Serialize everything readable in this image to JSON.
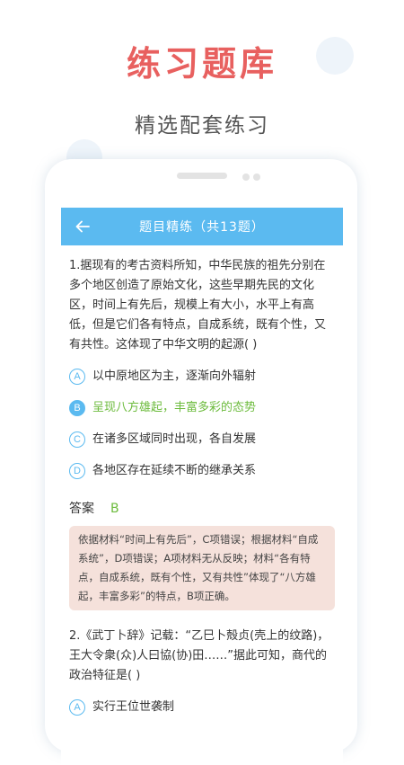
{
  "promo": {
    "title": "练习题库",
    "subtitle": "精选配套练习"
  },
  "app": {
    "header_title": "题目精练（共13题）",
    "back_icon": "arrow-left-icon",
    "accent": "#5bbaf0",
    "correct_color": "#6cbb3c"
  },
  "questions": [
    {
      "stem": "1.据现有的考古资料所知，中华民族的祖先分别在多个地区创造了原始文化，这些早期先民的文化区，时间上有先后，规模上有大小，水平上有高低，但是它们各有特点，自成系统，既有个性，又有共性。这体现了中华文明的起源(  )",
      "options": [
        {
          "letter": "A",
          "text": "以中原地区为主，逐渐向外辐射"
        },
        {
          "letter": "B",
          "text": "呈现八方雄起，丰富多彩的态势"
        },
        {
          "letter": "C",
          "text": "在诸多区域同时出现，各自发展"
        },
        {
          "letter": "D",
          "text": "各地区存在延续不断的继承关系"
        }
      ],
      "selected": "B",
      "answer_label": "答案",
      "answer": "B",
      "explanation": "依据材料“时间上有先后”，C项错误；根据材料“自成系统”，D项错误；A项材料无从反映；材料“各有特点，自成系统，既有个性，又有共性”体现了“八方雄起，丰富多彩”的特点，B项正确。"
    },
    {
      "stem": "2.《武丁卜辞》记载：“乙巳卜殻贞(壳上的纹路)，王大令衆(众)人曰協(协)田……”据此可知，商代的政治特征是(  )",
      "options": [
        {
          "letter": "A",
          "text": "实行王位世袭制"
        }
      ]
    }
  ]
}
